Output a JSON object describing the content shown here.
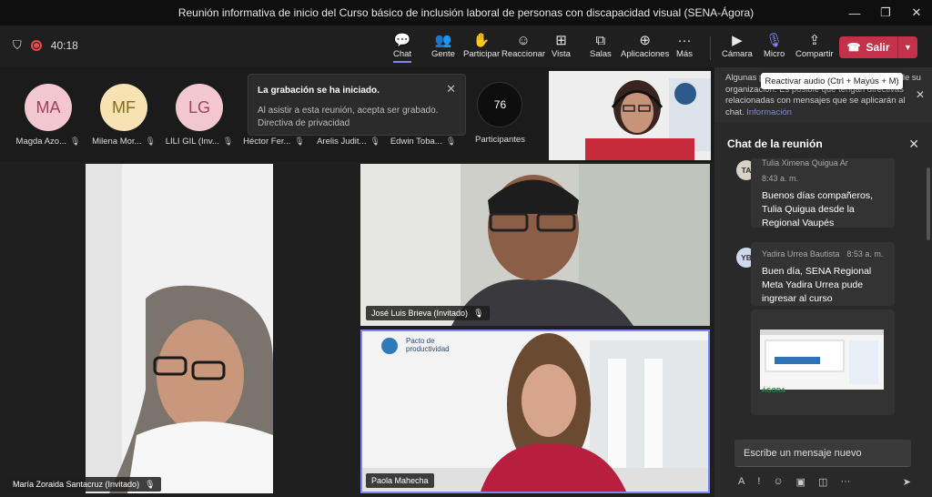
{
  "window": {
    "title": "Reunión informativa de inicio del Curso básico de inclusión laboral de personas con discapacidad visual (SENA-Ágora)"
  },
  "toolbar": {
    "timer": "40:18",
    "buttons": [
      {
        "label": "Chat",
        "icon": "chat-icon",
        "glyph": "💬"
      },
      {
        "label": "Gente",
        "icon": "people-icon",
        "glyph": "👥"
      },
      {
        "label": "Participar",
        "icon": "hand-icon",
        "glyph": "✋"
      },
      {
        "label": "Reaccionar",
        "icon": "emoji-icon",
        "glyph": "☺"
      },
      {
        "label": "Vista",
        "icon": "grid-icon",
        "glyph": "⊞"
      },
      {
        "label": "Salas",
        "icon": "rooms-icon",
        "glyph": "⧉"
      },
      {
        "label": "Aplicaciones",
        "icon": "apps-icon",
        "glyph": "⊕"
      },
      {
        "label": "Más",
        "icon": "more-icon",
        "glyph": "···"
      },
      {
        "label": "Cámara",
        "icon": "camera-icon",
        "glyph": "▶"
      },
      {
        "label": "Micro",
        "icon": "mic-off-icon",
        "glyph": "🎙"
      },
      {
        "label": "Compartir",
        "icon": "share-icon",
        "glyph": "⇪"
      }
    ],
    "leave_label": "Salir",
    "tooltip": "Reactivar audio (Ctrl + Mayús + M)"
  },
  "roster": {
    "people": [
      {
        "initials": "MA",
        "name": "Magda Azo...",
        "color": "#f3c7d0",
        "text": "#a0435a"
      },
      {
        "initials": "MF",
        "name": "Milena Mor...",
        "color": "#f6e2b3",
        "text": "#8a6a1c"
      },
      {
        "initials": "LG",
        "name": "LILI GIL (Inv...",
        "color": "#f3c7d0",
        "text": "#a0435a"
      }
    ],
    "names_only": [
      "Héctor Fer...",
      "Arelis Judit...",
      "Edwin Toba..."
    ],
    "participants_count": "76",
    "participants_label": "Participantes"
  },
  "toast": {
    "title": "La grabación se ha iniciado.",
    "body": "Al asistir a esta reunión, acepta ser grabado.",
    "link": "Directiva de privacidad"
  },
  "stage": {
    "tiles": [
      {
        "name": "María Zoraida Santacruz (Invitado)"
      },
      {
        "name": "José Luis Brieva (Invitado)"
      },
      {
        "name": "Paola Mahecha"
      }
    ],
    "slide_logo": "Pacto de productividad"
  },
  "chat": {
    "banner_text": "Algunas personas de la reunión son de fuera de su organización. Es posible que tengan directivas relacionadas con mensajes que se aplicarán al chat.",
    "banner_link": "Información",
    "header": "Chat de la reunión",
    "messages": [
      {
        "initials": "TA",
        "author": "Tulia Ximena Quigua Arroyave",
        "time": "8:43 a. m.",
        "text": "Buenos días compañeros, Tulia Quigua desde la Regional Vaupés"
      },
      {
        "initials": "YB",
        "author": "Yadira Urrea Bautista",
        "time": "8:53 a. m.",
        "text": "Buen día, SENA Regional Meta Yadira Urrea pude ingresar al curso"
      }
    ],
    "attachment_caption": "ÁGORA",
    "compose_placeholder": "Escribe un mensaje nuevo"
  },
  "colors": {
    "accent": "#7f85f5",
    "leave": "#c4314b",
    "bg": "#1f1f1f"
  }
}
